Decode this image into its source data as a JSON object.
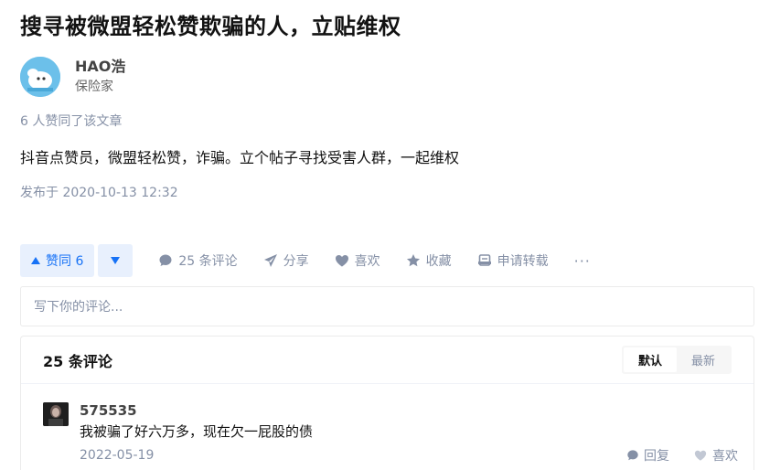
{
  "article": {
    "title": "搜寻被微盟轻松赞欺骗的人，立贴维权",
    "author_name": "HAO浩",
    "author_bio": "保险家",
    "likes_line": "6 人赞同了该文章",
    "content": "抖音点赞员，微盟轻松赞，诈骗。立个帖子寻找受害人群，一起维权",
    "publish": "发布于 2020-10-13 12:32"
  },
  "actions": {
    "upvote": "赞同 6",
    "comments": "25 条评论",
    "share": "分享",
    "like": "喜欢",
    "collect": "收藏",
    "repost": "申请转载",
    "more": "···"
  },
  "comment_input": {
    "placeholder": "写下你的评论..."
  },
  "comments": {
    "count_label": "25 条评论",
    "sort_default": "默认",
    "sort_latest": "最新",
    "items": [
      {
        "name": "575535",
        "text": "我被骗了好六万多，现在欠一屁股的债",
        "date": "2022-05-19",
        "reply": "回复",
        "like": "喜欢"
      }
    ]
  },
  "colors": {
    "accent": "#1772f6",
    "muted": "#8590a6"
  },
  "icons": [
    "upvote-icon",
    "downvote-icon",
    "comment-icon",
    "share-icon",
    "heart-icon",
    "star-icon",
    "repost-icon",
    "more-icon",
    "reply-icon"
  ]
}
